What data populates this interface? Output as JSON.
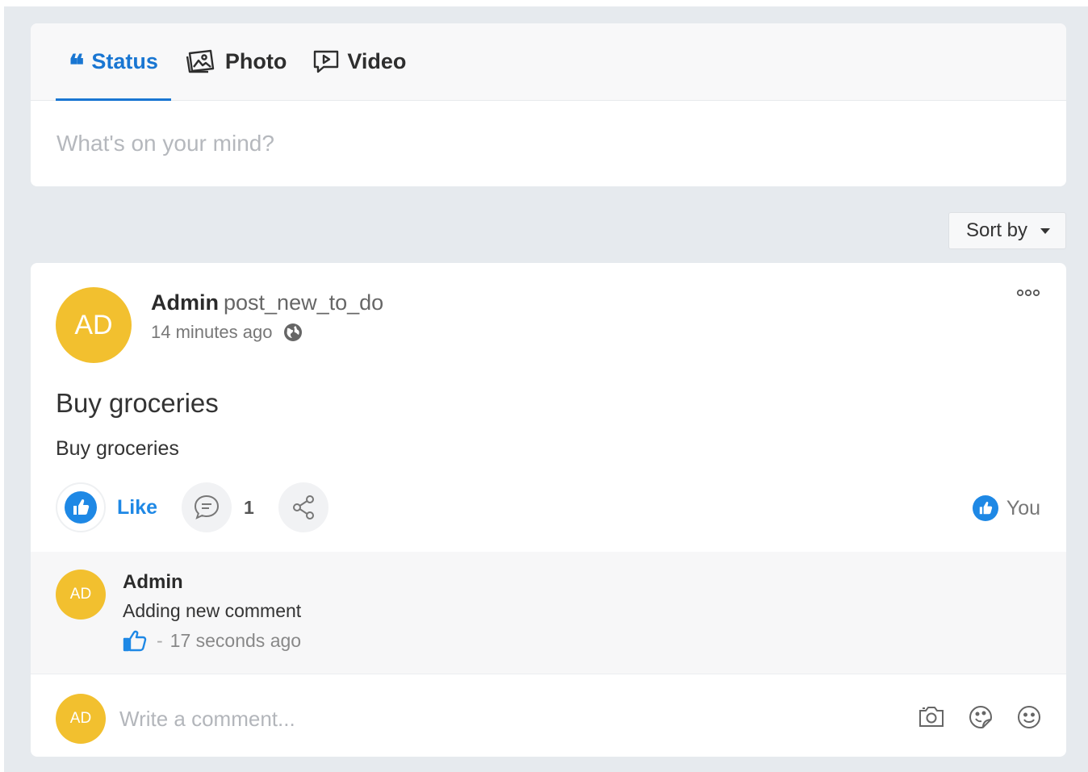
{
  "composer": {
    "tabs": [
      {
        "label": "Status",
        "icon": "quote-icon",
        "active": true
      },
      {
        "label": "Photo",
        "icon": "photo-icon",
        "active": false
      },
      {
        "label": "Video",
        "icon": "video-icon",
        "active": false
      }
    ],
    "placeholder": "What's on your mind?"
  },
  "sort": {
    "label": "Sort by"
  },
  "post": {
    "author": "Admin",
    "action": "post_new_to_do",
    "avatar_initials": "AD",
    "time": "14 minutes ago",
    "title": "Buy groceries",
    "body": "Buy groceries",
    "like_label": "Like",
    "comment_count": "1",
    "likers": "You"
  },
  "comments": [
    {
      "author": "Admin",
      "avatar_initials": "AD",
      "text": "Adding new comment",
      "separator": "-",
      "time": "17 seconds ago"
    }
  ],
  "write_comment": {
    "avatar_initials": "AD",
    "placeholder": "Write a comment..."
  },
  "colors": {
    "accent": "#1976d2",
    "like_blue": "#1e88e5",
    "avatar_yellow": "#f2c02f",
    "background": "#e6eaee"
  }
}
